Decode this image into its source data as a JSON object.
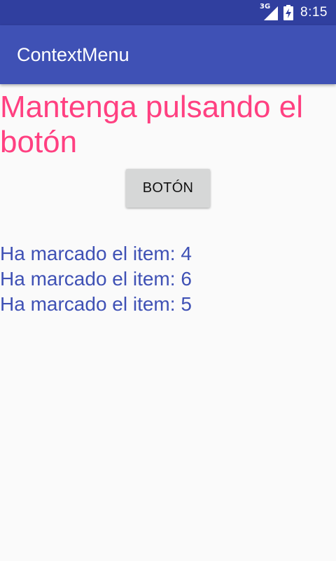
{
  "status_bar": {
    "network": "3G",
    "time": "8:15",
    "colors": {
      "background": "#303f9f",
      "text": "#ffffff"
    }
  },
  "app_bar": {
    "title": "ContextMenu",
    "colors": {
      "background": "#3f51b5",
      "text": "#ffffff"
    }
  },
  "main": {
    "instruction": "Mantenga pulsando el botón",
    "button_label": "BOTÓN",
    "log": [
      "Ha marcado el item: 4",
      "Ha marcado el item: 6",
      "Ha marcado el item: 5"
    ],
    "colors": {
      "background": "#fafafa",
      "instruction": "#ff4081",
      "log": "#3f51b5",
      "button": "#d6d7d7"
    }
  },
  "icons": {
    "signal": "signal-icon",
    "battery": "battery-charging-icon"
  }
}
